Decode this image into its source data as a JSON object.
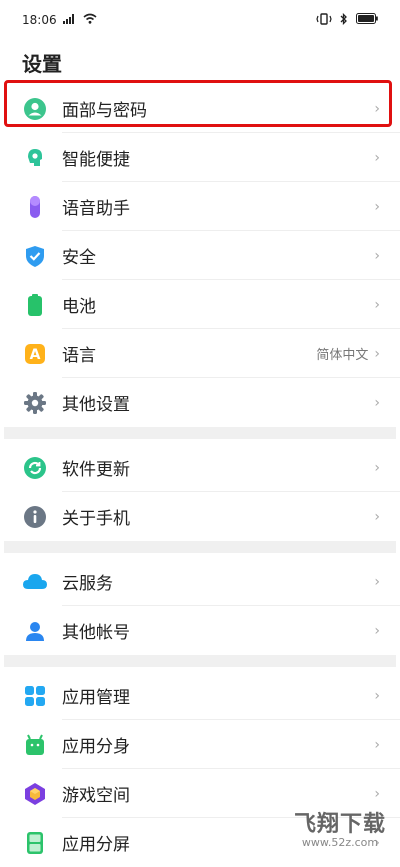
{
  "status": {
    "time": "18:06"
  },
  "page": {
    "title": "设置"
  },
  "groups": [
    [
      {
        "label": "面部与密码",
        "icon": "face-lock-icon",
        "value": ""
      },
      {
        "label": "智能便捷",
        "icon": "smart-assist-icon",
        "value": ""
      },
      {
        "label": "语音助手",
        "icon": "microphone-icon",
        "value": ""
      },
      {
        "label": "安全",
        "icon": "shield-icon",
        "value": ""
      },
      {
        "label": "电池",
        "icon": "battery-icon",
        "value": ""
      },
      {
        "label": "语言",
        "icon": "language-icon",
        "value": "简体中文"
      },
      {
        "label": "其他设置",
        "icon": "gear-icon",
        "value": ""
      }
    ],
    [
      {
        "label": "软件更新",
        "icon": "update-icon",
        "value": ""
      },
      {
        "label": "关于手机",
        "icon": "info-icon",
        "value": ""
      }
    ],
    [
      {
        "label": "云服务",
        "icon": "cloud-icon",
        "value": ""
      },
      {
        "label": "其他帐号",
        "icon": "account-icon",
        "value": ""
      }
    ],
    [
      {
        "label": "应用管理",
        "icon": "app-grid-icon",
        "value": ""
      },
      {
        "label": "应用分身",
        "icon": "app-clone-icon",
        "value": ""
      },
      {
        "label": "游戏空间",
        "icon": "game-icon",
        "value": ""
      },
      {
        "label": "应用分屏",
        "icon": "split-screen-icon",
        "value": ""
      }
    ]
  ],
  "watermark": {
    "title": "飞翔下载",
    "url": "www.52z.com"
  },
  "colors": {
    "highlight": "#e01010",
    "accent": "#2bc48a"
  }
}
